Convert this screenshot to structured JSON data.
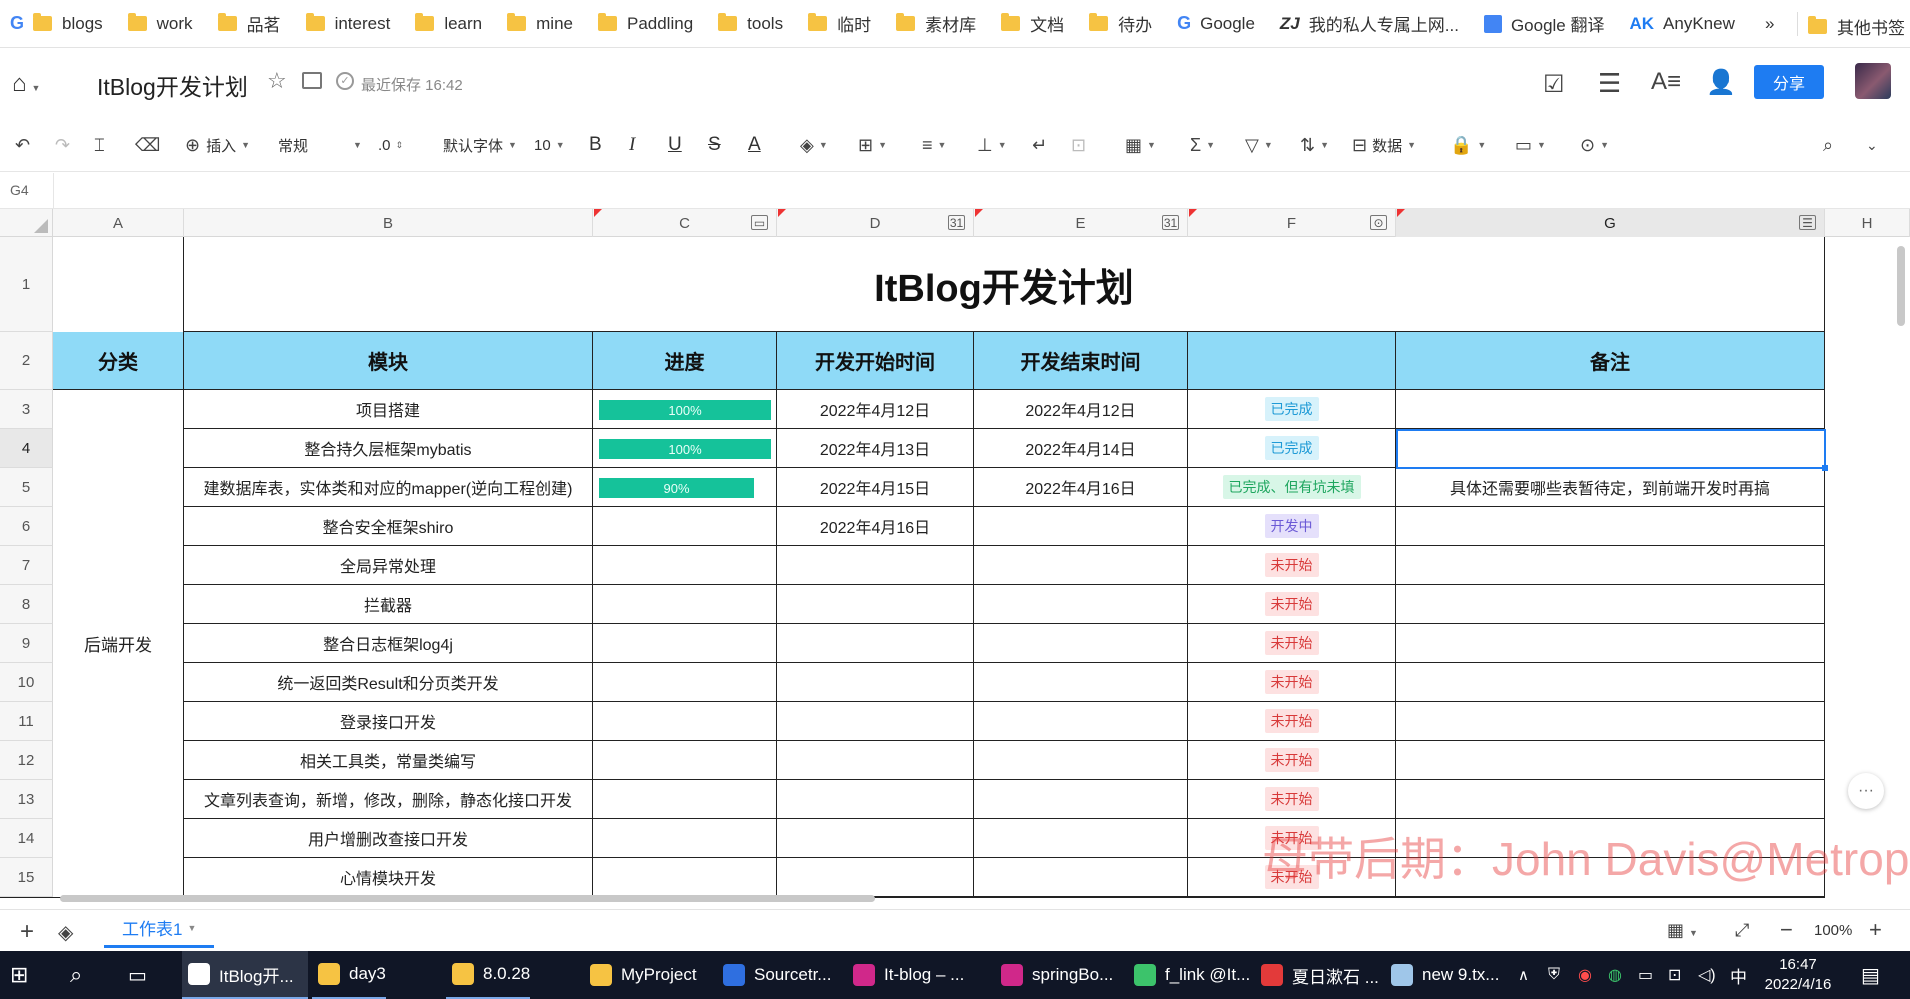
{
  "bookmarks": [
    "blogs",
    "work",
    "品茗",
    "interest",
    "learn",
    "mine",
    "Paddling",
    "tools",
    "临时",
    "素材库",
    "文档",
    "待办"
  ],
  "bookmarks_extra": {
    "google": "Google",
    "private": "我的私人专属上网...",
    "translate": "Google 翻译",
    "anyknew": "AnyKnew",
    "more": "»",
    "other": "其他书签"
  },
  "header": {
    "title": "ItBlog开发计划",
    "save_status": "最近保存 16:42",
    "share": "分享"
  },
  "toolbar": {
    "insert": "插入",
    "format": "常规",
    "decimal": ".0",
    "font": "默认字体",
    "size": "10",
    "bold": "B",
    "italic": "I",
    "underline": "U",
    "strike": "S",
    "font_color": "A",
    "data": "数据"
  },
  "formula_bar": {
    "cell_ref": "G4"
  },
  "columns": [
    "A",
    "B",
    "C",
    "D",
    "E",
    "F",
    "G",
    "H"
  ],
  "rows": [
    "1",
    "2",
    "3",
    "4",
    "5",
    "6",
    "7",
    "8",
    "9",
    "10",
    "11",
    "12",
    "13",
    "14",
    "15"
  ],
  "sheet": {
    "title": "ItBlog开发计划",
    "headers": [
      "分类",
      "模块",
      "进度",
      "开发开始时间",
      "开发结束时间",
      "",
      "备注"
    ],
    "category": "后端开发",
    "tasks": [
      {
        "module": "项目搭建",
        "progress": "100%",
        "progress_value": 1.0,
        "start": "2022年4月12日",
        "end": "2022年4月12日",
        "status": "已完成",
        "status_type": "done",
        "note": ""
      },
      {
        "module": "整合持久层框架mybatis",
        "progress": "100%",
        "progress_value": 1.0,
        "start": "2022年4月13日",
        "end": "2022年4月14日",
        "status": "已完成",
        "status_type": "done",
        "note": ""
      },
      {
        "module": "建数据库表，实体类和对应的mapper(逆向工程创建)",
        "progress": "90%",
        "progress_value": 0.9,
        "start": "2022年4月15日",
        "end": "2022年4月16日",
        "status": "已完成、但有坑未填",
        "status_type": "partial",
        "note": "具体还需要哪些表暂待定，到前端开发时再搞"
      },
      {
        "module": "整合安全框架shiro",
        "progress": "",
        "progress_value": 0,
        "start": "2022年4月16日",
        "end": "",
        "status": "开发中",
        "status_type": "doing",
        "note": ""
      },
      {
        "module": "全局异常处理",
        "progress": "",
        "progress_value": 0,
        "start": "",
        "end": "",
        "status": "未开始",
        "status_type": "todo",
        "note": ""
      },
      {
        "module": "拦截器",
        "progress": "",
        "progress_value": 0,
        "start": "",
        "end": "",
        "status": "未开始",
        "status_type": "todo",
        "note": ""
      },
      {
        "module": "整合日志框架log4j",
        "progress": "",
        "progress_value": 0,
        "start": "",
        "end": "",
        "status": "未开始",
        "status_type": "todo",
        "note": ""
      },
      {
        "module": "统一返回类Result和分页类开发",
        "progress": "",
        "progress_value": 0,
        "start": "",
        "end": "",
        "status": "未开始",
        "status_type": "todo",
        "note": ""
      },
      {
        "module": "登录接口开发",
        "progress": "",
        "progress_value": 0,
        "start": "",
        "end": "",
        "status": "未开始",
        "status_type": "todo",
        "note": ""
      },
      {
        "module": "相关工具类，常量类编写",
        "progress": "",
        "progress_value": 0,
        "start": "",
        "end": "",
        "status": "未开始",
        "status_type": "todo",
        "note": ""
      },
      {
        "module": "文章列表查询，新增，修改，删除，静态化接口开发",
        "progress": "",
        "progress_value": 0,
        "start": "",
        "end": "",
        "status": "未开始",
        "status_type": "todo",
        "note": ""
      },
      {
        "module": "用户增删改查接口开发",
        "progress": "",
        "progress_value": 0,
        "start": "",
        "end": "",
        "status": "未开始",
        "status_type": "todo",
        "note": ""
      },
      {
        "module": "心情模块开发",
        "progress": "",
        "progress_value": 0,
        "start": "",
        "end": "",
        "status": "未开始",
        "status_type": "todo",
        "note": ""
      }
    ]
  },
  "watermark": "母带后期：John Davis@Metrop",
  "sheet_tabs": {
    "active": "工作表1",
    "zoom": "100%"
  },
  "taskbar": {
    "apps": [
      {
        "label": "ItBlog开...",
        "color": "#ffffff"
      },
      {
        "label": "day3",
        "color": "#f6c343"
      },
      {
        "label": "8.0.28",
        "color": "#f6c343"
      },
      {
        "label": "MyProject",
        "color": "#f6c343"
      },
      {
        "label": "Sourcetr...",
        "color": "#2f6fe0"
      },
      {
        "label": "It-blog – ...",
        "color": "#d0288a"
      },
      {
        "label": "springBo...",
        "color": "#d0288a"
      },
      {
        "label": "f_link @It...",
        "color": "#3cc36b"
      },
      {
        "label": "夏日漱石 ...",
        "color": "#e33a3a"
      },
      {
        "label": "new 9.tx...",
        "color": "#9fc6e9"
      }
    ],
    "ime": "中",
    "time": "16:47",
    "date": "2022/4/16"
  },
  "colors": {
    "header_fill": "#8fdaf7",
    "progress": "#15c29a",
    "share": "#1e7cf2"
  }
}
